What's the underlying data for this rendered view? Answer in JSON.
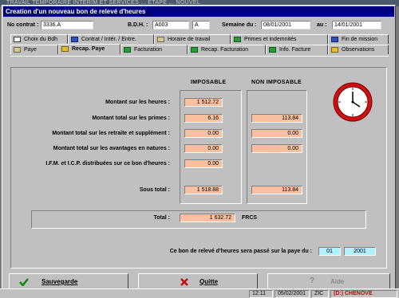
{
  "background": {
    "text": "TRAVAIL TEMPORAIRE INTERIM ET SERVICES ... ETAPE ... NOUVEL"
  },
  "window": {
    "title": "Creation d'un nouveau bon de relevé d'heures"
  },
  "header": {
    "contrat_label": "No contrat :",
    "contrat_value": "3336.A",
    "bdh_label": "B.D.H. :",
    "bdh_value": "A003",
    "bdh_suffix": "A",
    "semaine_label": "Semaine du :",
    "semaine_from": "08/01/2001",
    "au_label": "au :",
    "semaine_to": "14/01/2001"
  },
  "tabs_row1": [
    {
      "label": "Choix du Bdh",
      "icon": "document-icon"
    },
    {
      "label": "Contrat / Intér. / Entre.",
      "icon": "person-icon"
    },
    {
      "label": "Horaire de travail",
      "icon": "calendar-icon"
    },
    {
      "label": "Primes et indemnités",
      "icon": "money-icon"
    },
    {
      "label": "Fin de mission",
      "icon": "flag-icon"
    }
  ],
  "tabs_row2": [
    {
      "label": "Paye",
      "icon": "table-icon"
    },
    {
      "label": "Recap. Paye",
      "icon": "gear-icon",
      "active": true
    },
    {
      "label": "Facturation",
      "icon": "invoice-icon"
    },
    {
      "label": "Recap. Facturation",
      "icon": "invoice-icon"
    },
    {
      "label": "Info. Facture",
      "icon": "info-icon"
    },
    {
      "label": "Observations",
      "icon": "notes-icon"
    }
  ],
  "recap": {
    "col_imposable": "IMPOSABLE",
    "col_non_imposable": "NON IMPOSABLE",
    "rows": [
      {
        "label": "Montant sur les heures :",
        "imposable": "1 512.72",
        "non_imposable": ""
      },
      {
        "label": "Montant total sur les primes :",
        "imposable": "6.16",
        "non_imposable": "113.84"
      },
      {
        "label": "Montant total sur les retraite et supplément :",
        "imposable": "0.00",
        "non_imposable": "0.00"
      },
      {
        "label": "Montant total sur les avantages en natures :",
        "imposable": "0.00",
        "non_imposable": "0.00"
      },
      {
        "label": "I.F.M. et I.C.P. distribuées sur ce bon d'heures :",
        "imposable": "0.00",
        "non_imposable": ""
      }
    ],
    "sous_total_label": "Sous total :",
    "sous_total_imposable": "1 518.88",
    "sous_total_non_imposable": "113.84",
    "total_label": "Total :",
    "total_value": "1 632.72",
    "currency": "FRCS",
    "paye_label": "Ce bon de relevé d'heures sera passé sur la paye du :",
    "paye_month": "01",
    "paye_year": "2001"
  },
  "buttons": {
    "save": "Sauvegarde",
    "quit": "Quitte",
    "help": "Aide"
  },
  "statusbar": {
    "cells": [
      "12:11",
      "05/02/2001",
      "ZIC",
      "(D:) CHENOVE"
    ]
  },
  "colors": {
    "title": "#000080",
    "value_bg": "#f8c0a0",
    "period_bg": "#b0f0ff",
    "clock": "#d01010"
  }
}
